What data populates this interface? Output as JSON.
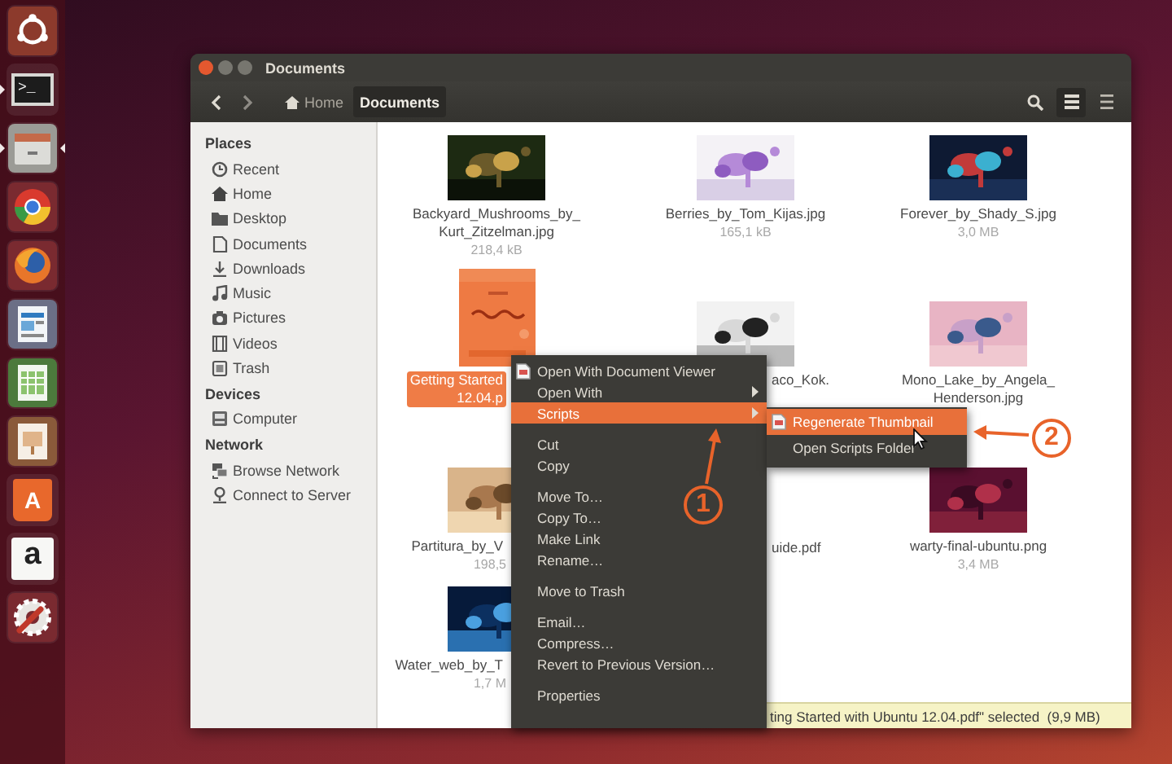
{
  "launcher": [
    {
      "kind": "logo",
      "running": false,
      "focused": false
    },
    {
      "kind": "terminal",
      "text": ">_",
      "running": true,
      "focused": false
    },
    {
      "kind": "cabinet",
      "running": true,
      "focused": true
    },
    {
      "kind": "browser-a",
      "running": false,
      "focused": false
    },
    {
      "kind": "browser-b",
      "running": false,
      "focused": false
    },
    {
      "kind": "writer",
      "running": false,
      "focused": false
    },
    {
      "kind": "sheet",
      "running": false,
      "focused": false
    },
    {
      "kind": "slides",
      "running": false,
      "focused": false
    },
    {
      "kind": "bag",
      "text": "A",
      "running": false,
      "focused": false
    },
    {
      "kind": "letter",
      "text": "a",
      "running": false,
      "focused": false
    },
    {
      "kind": "gear",
      "running": false,
      "focused": false
    }
  ],
  "window": {
    "title": "Documents"
  },
  "toolbar": {
    "breadcrumbs": [
      {
        "label": "Home",
        "kind": "home",
        "selected": false
      },
      {
        "label": "Documents",
        "kind": "plain",
        "selected": true
      }
    ]
  },
  "sidebar": {
    "sections": [
      {
        "title": "Places",
        "items": [
          {
            "label": "Recent",
            "kind": "clock",
            "selected": false
          },
          {
            "label": "Home",
            "kind": "home",
            "selected": false
          },
          {
            "label": "Desktop",
            "kind": "folder",
            "selected": false
          },
          {
            "label": "Documents",
            "kind": "document",
            "selected": false
          },
          {
            "label": "Downloads",
            "kind": "download",
            "selected": false
          },
          {
            "label": "Music",
            "kind": "music",
            "selected": false
          },
          {
            "label": "Pictures",
            "kind": "camera",
            "selected": false
          },
          {
            "label": "Videos",
            "kind": "film",
            "selected": false
          },
          {
            "label": "Trash",
            "kind": "trash",
            "selected": false
          }
        ]
      },
      {
        "title": "Devices",
        "items": [
          {
            "label": "Computer",
            "kind": "drive",
            "selected": false
          }
        ]
      },
      {
        "title": "Network",
        "items": [
          {
            "label": "Browse Network",
            "kind": "network",
            "selected": false
          },
          {
            "label": "Connect to Server",
            "kind": "pin",
            "selected": false
          }
        ]
      }
    ]
  },
  "files": [
    {
      "name": "Backyard_Mushrooms_by_\nKurt_Zitzelman.jpg",
      "size": "218,4 kB",
      "kind": "picture",
      "selected": false,
      "cut": false
    },
    {
      "name": "Berries_by_Tom_Kijas.jpg",
      "size": "165,1 kB",
      "kind": "picture",
      "selected": false,
      "cut": false
    },
    {
      "name": "Forever_by_Shady_S.jpg",
      "size": "3,0 MB",
      "kind": "picture",
      "selected": false,
      "cut": false
    },
    {
      "name": "Getting Started\n12.04.p",
      "kind": "document",
      "selected": true,
      "cut": true
    },
    {
      "name": "aco_Kok.",
      "kind": "picture",
      "selected": false,
      "cut": true
    },
    {
      "name": "Mono_Lake_by_Angela_\nHenderson.jpg",
      "kind": "picture",
      "selected": false,
      "cut": false
    },
    {
      "name": "Partitura_by_V",
      "size": "198,5",
      "kind": "picture",
      "selected": false,
      "cut": true
    },
    {
      "name": "uide.pdf",
      "kind": "hidden",
      "selected": false,
      "cut": true
    },
    {
      "name": "warty-final-ubuntu.png",
      "size": "3,4 MB",
      "kind": "picture",
      "selected": false,
      "cut": false
    },
    {
      "name": "Water_web_by_T",
      "size": "1,7 M",
      "kind": "picture",
      "selected": false,
      "cut": true
    }
  ],
  "status_bar": {
    "text": "ting Started with Ubuntu 12.04.pdf\" selected  (9,9 MB)"
  },
  "context_menu": {
    "items": [
      {
        "kind": "icon-item",
        "label": "Open With Document Viewer",
        "selected": false
      },
      {
        "kind": "submenu",
        "label": "Open With",
        "selected": false
      },
      {
        "kind": "submenu",
        "label": "Scripts",
        "selected": true
      },
      {
        "kind": "separator"
      },
      {
        "kind": "item",
        "label": "Cut",
        "selected": false
      },
      {
        "kind": "item",
        "label": "Copy",
        "selected": false
      },
      {
        "kind": "separator"
      },
      {
        "kind": "item",
        "label": "Move To…",
        "selected": false
      },
      {
        "kind": "item",
        "label": "Copy To…",
        "selected": false
      },
      {
        "kind": "item",
        "label": "Make Link",
        "selected": false
      },
      {
        "kind": "item",
        "label": "Rename…",
        "selected": false
      },
      {
        "kind": "separator"
      },
      {
        "kind": "item",
        "label": "Move to Trash",
        "selected": false
      },
      {
        "kind": "separator"
      },
      {
        "kind": "item",
        "label": "Email…",
        "selected": false
      },
      {
        "kind": "item",
        "label": "Compress…",
        "selected": false
      },
      {
        "kind": "item",
        "label": "Revert to Previous Version…",
        "selected": false
      },
      {
        "kind": "separator"
      },
      {
        "kind": "item",
        "label": "Properties",
        "selected": false
      }
    ]
  },
  "submenu": {
    "items": [
      {
        "kind": "icon-item",
        "label": "Regenerate Thumbnail",
        "selected": true
      },
      {
        "kind": "item",
        "label": "Open Scripts Folder",
        "selected": false
      }
    ]
  },
  "callouts": [
    {
      "number": "1"
    },
    {
      "number": "2"
    }
  ]
}
